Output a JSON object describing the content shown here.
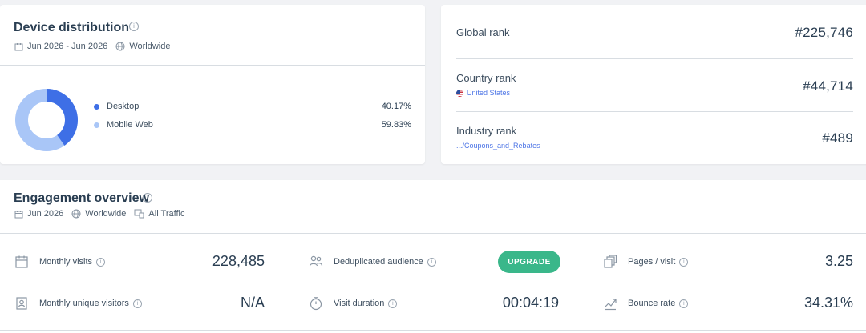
{
  "device": {
    "title": "Device distribution",
    "date_range": "Jun 2026 - Jun 2026",
    "region": "Worldwide",
    "items": [
      {
        "label": "Desktop",
        "value": "40.17%",
        "percent": 40.17,
        "color": "#3e6fe6"
      },
      {
        "label": "Mobile Web",
        "value": "59.83%",
        "percent": 59.83,
        "color": "#a9c6f7"
      }
    ]
  },
  "ranks": {
    "global": {
      "label": "Global rank",
      "value": "#225,746"
    },
    "country": {
      "label": "Country rank",
      "sub": "United States",
      "value": "#44,714"
    },
    "industry": {
      "label": "Industry rank",
      "sub": ".../Coupons_and_Rebates",
      "value": "#489"
    }
  },
  "engagement": {
    "title": "Engagement overview",
    "date": "Jun 2026",
    "region": "Worldwide",
    "traffic": "All Traffic",
    "metrics": {
      "monthly_visits": {
        "label": "Monthly visits",
        "value": "228,485"
      },
      "deduplicated_audience": {
        "label": "Deduplicated audience",
        "action": "UPGRADE"
      },
      "pages_per_visit": {
        "label": "Pages / visit",
        "value": "3.25"
      },
      "monthly_unique_visitors": {
        "label": "Monthly unique visitors",
        "value": "N/A"
      },
      "visit_duration": {
        "label": "Visit duration",
        "value": "00:04:19"
      },
      "bounce_rate": {
        "label": "Bounce rate",
        "value": "34.31%"
      }
    }
  },
  "colors": {
    "accent_green": "#3ab78a",
    "link_blue": "#4e76e6"
  }
}
